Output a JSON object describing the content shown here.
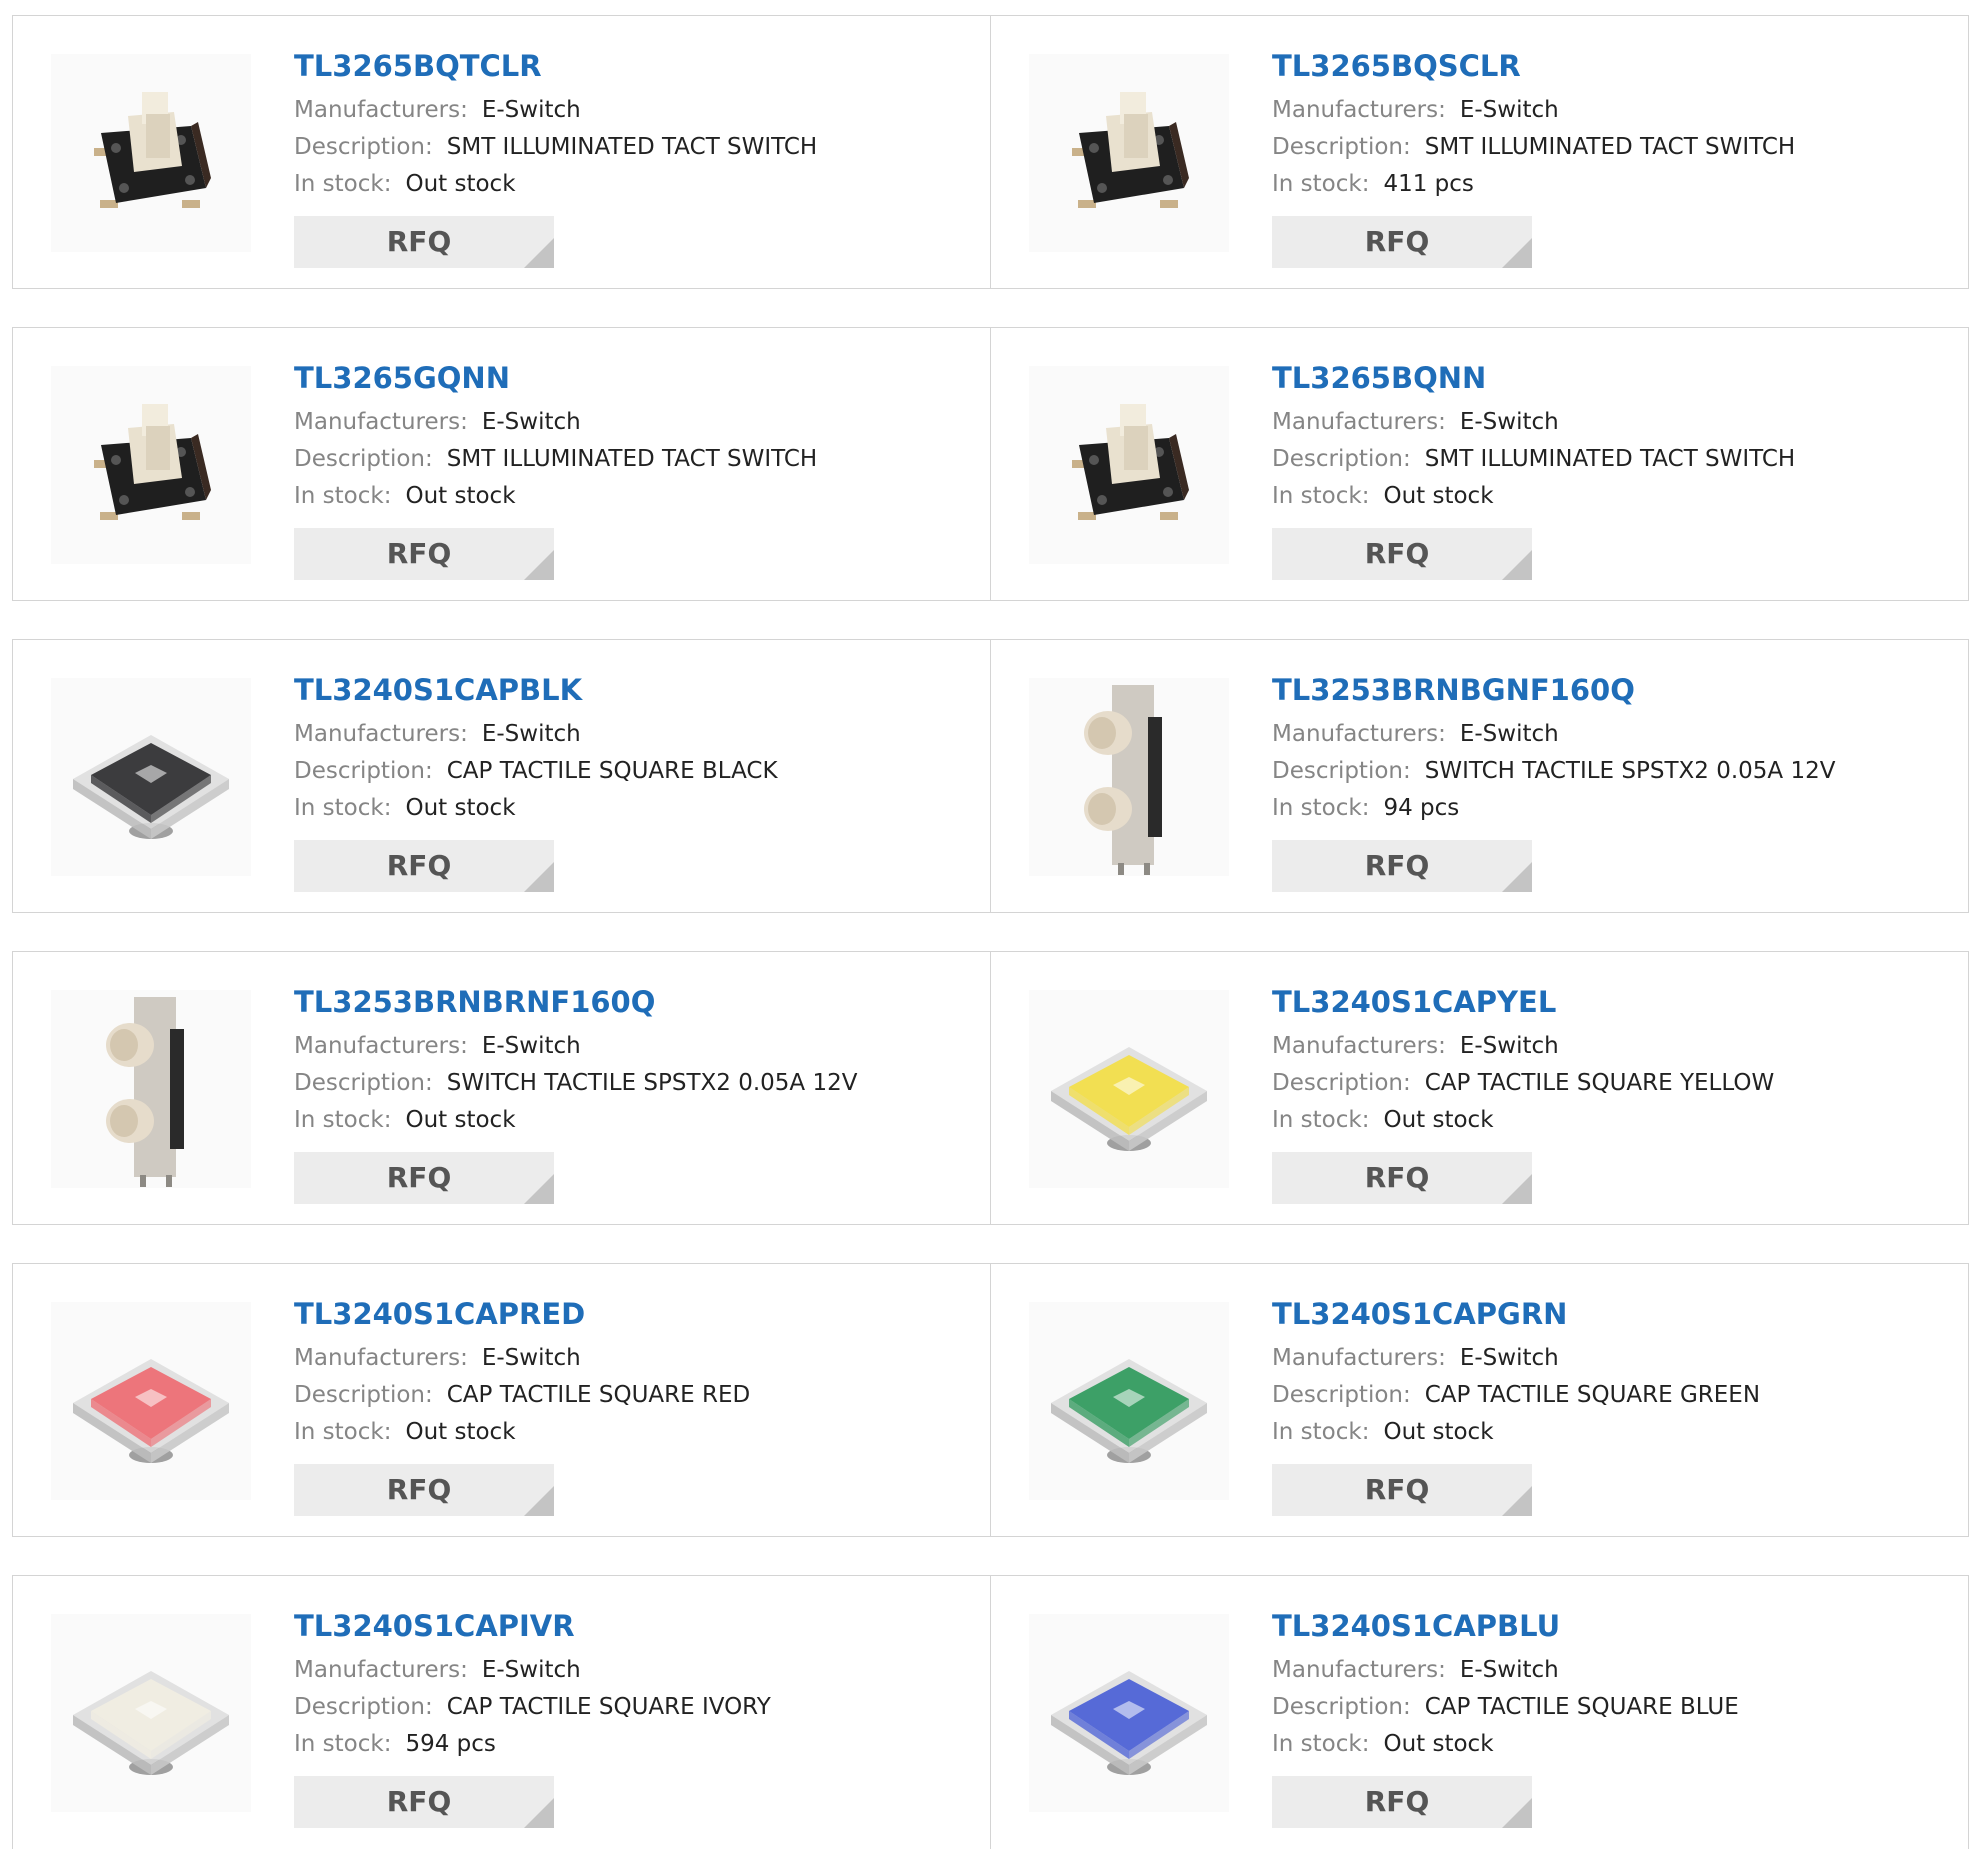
{
  "labels": {
    "manufacturer": "Manufacturers:",
    "description": "Description:",
    "stock": "In stock:",
    "rfq": "RFQ"
  },
  "colors": {
    "part_link": "#1f6db8",
    "label_gray": "#858585",
    "button_bg": "#ececec"
  },
  "products": [
    {
      "part": "TL3265BQTCLR",
      "manufacturer": "E-Switch",
      "description": "SMT ILLUMINATED TACT SWITCH",
      "stock": "Out stock",
      "image": "tact-switch-illuminated"
    },
    {
      "part": "TL3265BQSCLR",
      "manufacturer": "E-Switch",
      "description": "SMT ILLUMINATED TACT SWITCH",
      "stock": "411 pcs",
      "image": "tact-switch-illuminated"
    },
    {
      "part": "TL3265GQNN",
      "manufacturer": "E-Switch",
      "description": "SMT ILLUMINATED TACT SWITCH",
      "stock": "Out stock",
      "image": "tact-switch-illuminated"
    },
    {
      "part": "TL3265BQNN",
      "manufacturer": "E-Switch",
      "description": "SMT ILLUMINATED TACT SWITCH",
      "stock": "Out stock",
      "image": "tact-switch-illuminated"
    },
    {
      "part": "TL3240S1CAPBLK",
      "manufacturer": "E-Switch",
      "description": "CAP TACTILE SQUARE BLACK",
      "stock": "Out stock",
      "image": "square-cap",
      "cap_color": "#2e2e30"
    },
    {
      "part": "TL3253BRNBGNF160Q",
      "manufacturer": "E-Switch",
      "description": "SWITCH TACTILE SPSTX2 0.05A 12V",
      "stock": "94 pcs",
      "image": "tact-switch-dual"
    },
    {
      "part": "TL3253BRNBRNF160Q",
      "manufacturer": "E-Switch",
      "description": "SWITCH TACTILE SPSTX2 0.05A 12V",
      "stock": "Out stock",
      "image": "tact-switch-dual"
    },
    {
      "part": "TL3240S1CAPYEL",
      "manufacturer": "E-Switch",
      "description": "CAP TACTILE SQUARE YELLOW",
      "stock": "Out stock",
      "image": "square-cap",
      "cap_color": "#f3de45"
    },
    {
      "part": "TL3240S1CAPRED",
      "manufacturer": "E-Switch",
      "description": "CAP TACTILE SQUARE RED",
      "stock": "Out stock",
      "image": "square-cap",
      "cap_color": "#ee6b72"
    },
    {
      "part": "TL3240S1CAPGRN",
      "manufacturer": "E-Switch",
      "description": "CAP TACTILE SQUARE GREEN",
      "stock": "Out stock",
      "image": "square-cap",
      "cap_color": "#2f9a5c"
    },
    {
      "part": "TL3240S1CAPIVR",
      "manufacturer": "E-Switch",
      "description": "CAP TACTILE SQUARE IVORY",
      "stock": "594 pcs",
      "image": "square-cap",
      "cap_color": "#f1eee2"
    },
    {
      "part": "TL3240S1CAPBLU",
      "manufacturer": "E-Switch",
      "description": "CAP TACTILE SQUARE BLUE",
      "stock": "Out stock",
      "image": "square-cap",
      "cap_color": "#4a5fd6"
    }
  ]
}
